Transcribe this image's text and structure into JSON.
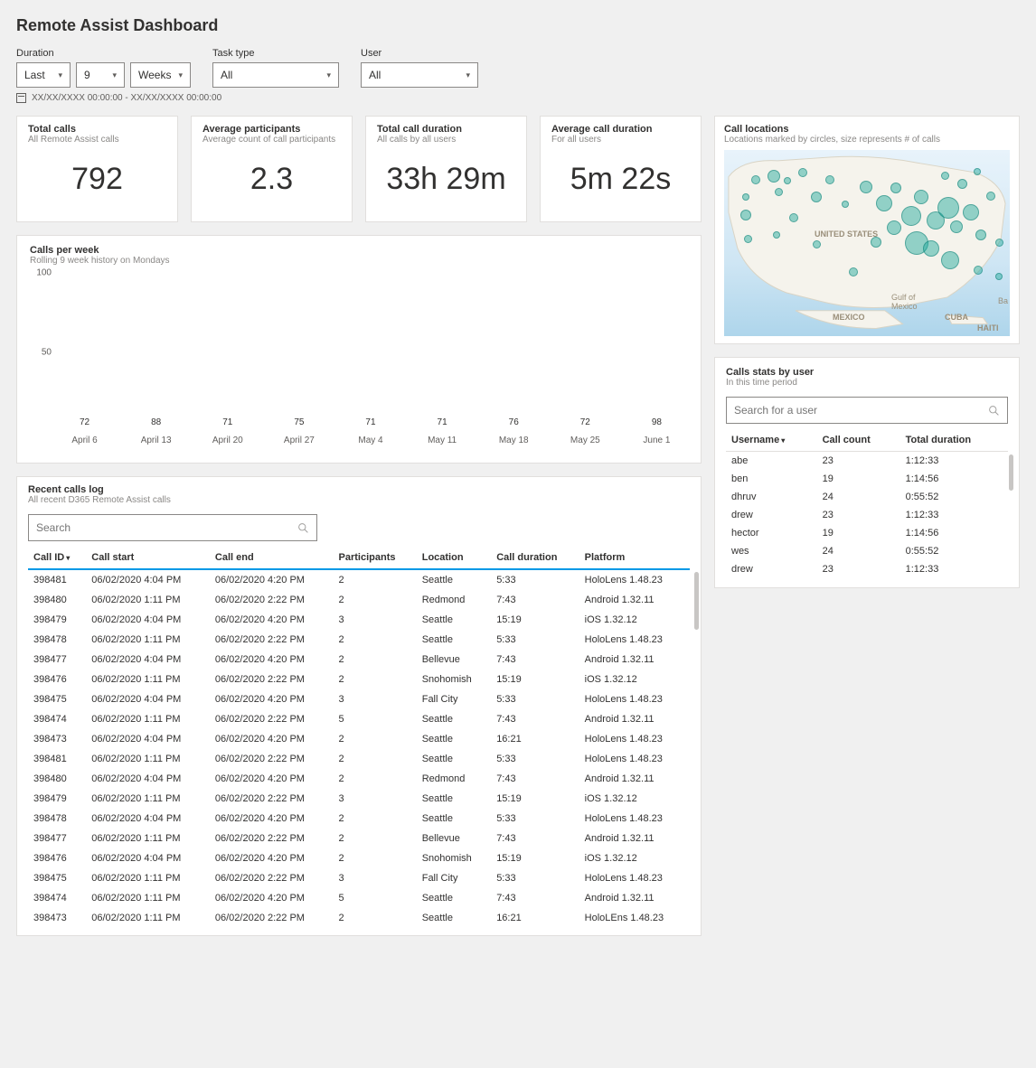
{
  "page_title": "Remote Assist Dashboard",
  "filters": {
    "duration_label": "Duration",
    "duration_mode": "Last",
    "duration_count": "9",
    "duration_unit": "Weeks",
    "task_label": "Task type",
    "task_value": "All",
    "user_label": "User",
    "user_value": "All",
    "date_range": "XX/XX/XXXX 00:00:00 - XX/XX/XXXX 00:00:00"
  },
  "kpis": [
    {
      "title": "Total calls",
      "sub": "All Remote Assist calls",
      "value": "792"
    },
    {
      "title": "Average participants",
      "sub": "Average count of call participants",
      "value": "2.3"
    },
    {
      "title": "Total call duration",
      "sub": "All calls by all users",
      "value": "33h 29m"
    },
    {
      "title": "Average call duration",
      "sub": "For all users",
      "value": "5m 22s"
    }
  ],
  "chart": {
    "title": "Calls per week",
    "sub": "Rolling 9 week history on Mondays"
  },
  "chart_data": {
    "type": "bar",
    "categories": [
      "April 6",
      "April 13",
      "April 20",
      "April 27",
      "May 4",
      "May 11",
      "May 18",
      "May 25",
      "June 1"
    ],
    "values": [
      72,
      88,
      71,
      75,
      71,
      71,
      76,
      72,
      98
    ],
    "title": "Calls per week",
    "xlabel": "",
    "ylabel": "",
    "ylim": [
      0,
      100
    ],
    "yticks": [
      50,
      100
    ]
  },
  "calls_log": {
    "title": "Recent calls log",
    "sub": "All recent D365 Remote Assist calls",
    "search_placeholder": "Search",
    "columns": [
      "Call ID",
      "Call start",
      "Call end",
      "Participants",
      "Location",
      "Call duration",
      "Platform"
    ],
    "sort_col": "Call ID",
    "rows": [
      [
        "398481",
        "06/02/2020 4:04 PM",
        "06/02/2020 4:20 PM",
        "2",
        "Seattle",
        "5:33",
        "HoloLens 1.48.23"
      ],
      [
        "398480",
        "06/02/2020 1:11 PM",
        "06/02/2020 2:22 PM",
        "2",
        "Redmond",
        "7:43",
        "Android 1.32.11"
      ],
      [
        "398479",
        "06/02/2020 4:04 PM",
        "06/02/2020 4:20 PM",
        "3",
        "Seattle",
        "15:19",
        "iOS 1.32.12"
      ],
      [
        "398478",
        "06/02/2020 1:11 PM",
        "06/02/2020 2:22 PM",
        "2",
        "Seattle",
        "5:33",
        "HoloLens 1.48.23"
      ],
      [
        "398477",
        "06/02/2020 4:04 PM",
        "06/02/2020 4:20 PM",
        "2",
        "Bellevue",
        "7:43",
        "Android 1.32.11"
      ],
      [
        "398476",
        "06/02/2020 1:11 PM",
        "06/02/2020 2:22 PM",
        "2",
        "Snohomish",
        "15:19",
        "iOS 1.32.12"
      ],
      [
        "398475",
        "06/02/2020 4:04 PM",
        "06/02/2020 4:20 PM",
        "3",
        "Fall City",
        "5:33",
        "HoloLens 1.48.23"
      ],
      [
        "398474",
        "06/02/2020 1:11 PM",
        "06/02/2020 2:22 PM",
        "5",
        "Seattle",
        "7:43",
        "Android 1.32.11"
      ],
      [
        "398473",
        "06/02/2020 4:04 PM",
        "06/02/2020 4:20 PM",
        "2",
        "Seattle",
        "16:21",
        "HoloLens 1.48.23"
      ],
      [
        "398481",
        "06/02/2020 1:11 PM",
        "06/02/2020 2:22 PM",
        "2",
        "Seattle",
        "5:33",
        "HoloLens 1.48.23"
      ],
      [
        "398480",
        "06/02/2020 4:04 PM",
        "06/02/2020 4:20 PM",
        "2",
        "Redmond",
        "7:43",
        "Android 1.32.11"
      ],
      [
        "398479",
        "06/02/2020 1:11 PM",
        "06/02/2020 2:22 PM",
        "3",
        "Seattle",
        "15:19",
        "iOS 1.32.12"
      ],
      [
        "398478",
        "06/02/2020 4:04 PM",
        "06/02/2020 4:20 PM",
        "2",
        "Seattle",
        "5:33",
        "HoloLens 1.48.23"
      ],
      [
        "398477",
        "06/02/2020 1:11 PM",
        "06/02/2020 2:22 PM",
        "2",
        "Bellevue",
        "7:43",
        "Android 1.32.11"
      ],
      [
        "398476",
        "06/02/2020 4:04 PM",
        "06/02/2020 4:20 PM",
        "2",
        "Snohomish",
        "15:19",
        "iOS 1.32.12"
      ],
      [
        "398475",
        "06/02/2020 1:11 PM",
        "06/02/2020 2:22 PM",
        "3",
        "Fall City",
        "5:33",
        "HoloLens 1.48.23"
      ],
      [
        "398474",
        "06/02/2020 1:11 PM",
        "06/02/2020 4:20 PM",
        "5",
        "Seattle",
        "7:43",
        "Android 1.32.11"
      ],
      [
        "398473",
        "06/02/2020 1:11 PM",
        "06/02/2020 2:22 PM",
        "2",
        "Seattle",
        "16:21",
        "HoloLEns 1.48.23"
      ]
    ]
  },
  "map_card": {
    "title": "Call locations",
    "sub": "Locations marked by circles, size represents # of calls",
    "labels": {
      "us": "UNITED STATES",
      "mexico": "MEXICO",
      "gulf": "Gulf of\nMexico",
      "cuba": "CUBA",
      "haiti": "HAITI",
      "ba": "Ba"
    }
  },
  "user_stats": {
    "title": "Calls stats by user",
    "sub": "In this time period",
    "search_placeholder": "Search for a user",
    "columns": [
      "Username",
      "Call count",
      "Total duration"
    ],
    "sort_col": "Username",
    "rows": [
      [
        "abe",
        "23",
        "1:12:33"
      ],
      [
        "ben",
        "19",
        "1:14:56"
      ],
      [
        "dhruv",
        "24",
        "0:55:52"
      ],
      [
        "drew",
        "23",
        "1:12:33"
      ],
      [
        "hector",
        "19",
        "1:14:56"
      ],
      [
        "wes",
        "24",
        "0:55:52"
      ],
      [
        "drew",
        "23",
        "1:12:33"
      ]
    ]
  }
}
